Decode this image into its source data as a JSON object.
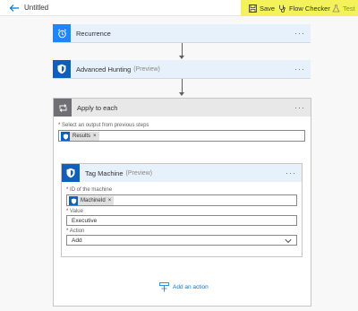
{
  "header": {
    "title": "Untitled",
    "save_label": "Save",
    "flow_checker_label": "Flow Checker",
    "test_label": "Test"
  },
  "steps": {
    "recurrence": {
      "label": "Recurrence"
    },
    "advanced_hunting": {
      "label": "Advanced Hunting",
      "tag": "(Preview)"
    },
    "apply_to_each": {
      "label": "Apply to each",
      "select_label": "Select an output from previous steps",
      "token": "Results",
      "add_action_label": "Add an action"
    },
    "tag_machine": {
      "label": "Tag Machine",
      "tag": "(Preview)",
      "id_label": "ID of the machine",
      "id_token": "MachineId",
      "value_label": "Value",
      "value": "Executive",
      "action_label": "Action",
      "action_value": "Add"
    }
  },
  "more_menu_glyph": "···",
  "token_remove_glyph": "×",
  "required_mark": "*",
  "colors": {
    "accent": "#0078d4",
    "highlight": "#f3f25a",
    "step_header": "#e7f1fb",
    "defender_blue": "#0f5fbc",
    "loop_gray": "#6f6f75"
  }
}
